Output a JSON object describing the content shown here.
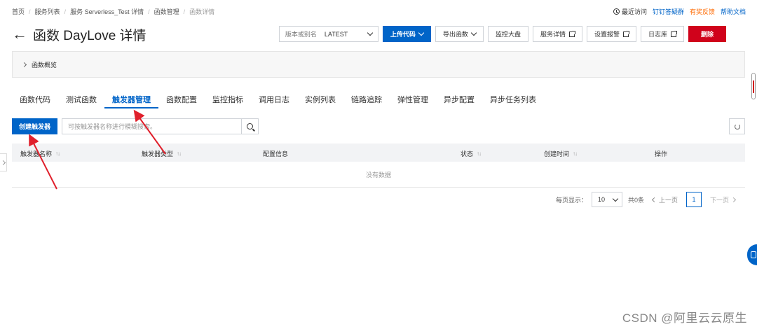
{
  "breadcrumb": [
    "首页",
    "服务列表",
    "服务 Serverless_Test 详情",
    "函数管理",
    "函数详情"
  ],
  "toplinks": {
    "recent": "最近访问",
    "dingtalk": "钉钉答疑群",
    "feedback": "有奖反馈",
    "docs": "帮助文档"
  },
  "page": {
    "title": "函数 DayLove 详情"
  },
  "actions": {
    "version_label": "版本或别名",
    "version_value": "LATEST",
    "upload": "上传代码",
    "export": "导出函数",
    "monitor": "监控大盘",
    "service_details": "服务详情",
    "alerts": "设置报警",
    "logstore": "日志库",
    "delete": "删除"
  },
  "overview": {
    "label": "函数概览"
  },
  "tabs": [
    "函数代码",
    "测试函数",
    "触发器管理",
    "函数配置",
    "监控指标",
    "调用日志",
    "实例列表",
    "链路追踪",
    "弹性管理",
    "异步配置",
    "异步任务列表"
  ],
  "toolbar": {
    "create": "创建触发器",
    "search_placeholder": "可按触发器名称进行模糊搜索。"
  },
  "table": {
    "columns": [
      "触发器名称",
      "触发器类型",
      "配置信息",
      "状态",
      "创建时间",
      "操作"
    ],
    "empty": "没有数据"
  },
  "pager": {
    "per_page_label": "每页显示：",
    "per_page": "10",
    "total": "共0条",
    "prev": "上一页",
    "current": "1",
    "next": "下一页"
  },
  "watermark": "CSDN @阿里云云原生",
  "colors": {
    "primary": "#0064c8",
    "danger": "#d0021b",
    "annotation": "#e0202c"
  }
}
